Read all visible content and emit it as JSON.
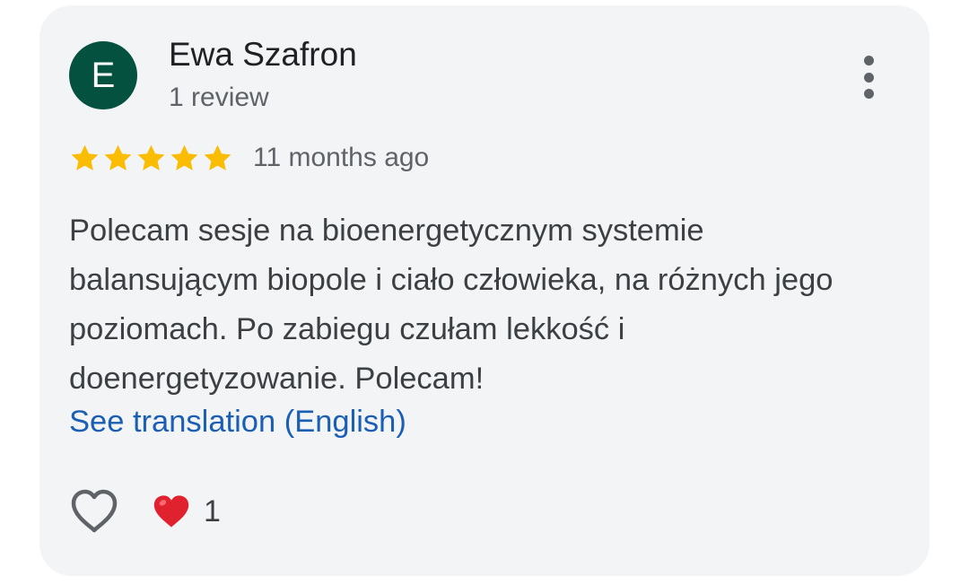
{
  "reviewer": {
    "initial": "E",
    "name": "Ewa Szafron",
    "review_count": "1 review",
    "avatar_color": "#05513f"
  },
  "rating": {
    "stars": 5,
    "max_stars": 5,
    "star_color": "#fbbc04",
    "date": "11 months ago"
  },
  "review": {
    "text": "Polecam sesje na bioenergetycznym systemie balansującym biopole i ciało człowieka, na różnych jego poziomach. Po zabiegu czułam lekkość i doenergetyzowanie. Polecam!",
    "translate_label": "See translation (English)"
  },
  "actions": {
    "like_icon": "heart-outline-icon",
    "reaction_icon": "red-heart-icon",
    "reaction_count": "1",
    "more_icon": "more-vert-icon"
  }
}
